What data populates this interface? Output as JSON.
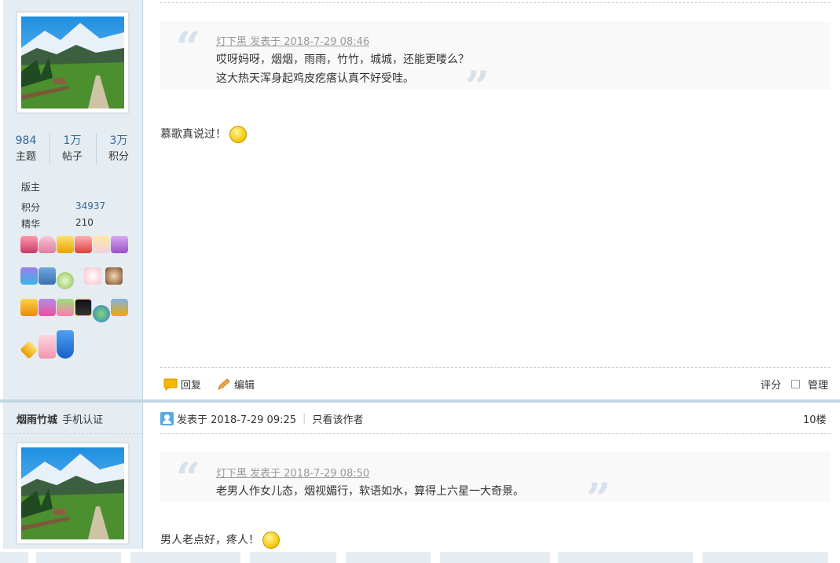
{
  "post1": {
    "stats": [
      {
        "num": "984",
        "label": "主题"
      },
      {
        "num": "1万",
        "label": "帖子"
      },
      {
        "num": "3万",
        "label": "积分"
      }
    ],
    "group": "版主",
    "points_label": "积分",
    "points_value": "34937",
    "digest_label": "精华",
    "digest_value": "210",
    "quote_header": "灯下黑 发表于 2018-7-29 08:46",
    "quote_line1": "哎呀妈呀，烟烟，雨雨，竹竹，城城，还能更喽么？",
    "quote_line2": "这大热天浑身起鸡皮疙瘩认真不好受哇。",
    "message": "慕歌真说过！",
    "reply": "回复",
    "edit": "编辑",
    "rate": "评分",
    "manage": "管理"
  },
  "post2": {
    "author": "烟雨竹城",
    "verify": "手机认证",
    "posted": "发表于 2018-7-29 09:25",
    "only_author": "只看该作者",
    "floor": "10楼",
    "quote_header": "灯下黑 发表于 2018-7-29 08:50",
    "quote_line1": "老男人作女儿态，烟视媚行，软语如水，算得上六星一大奇景。",
    "message": "男人老点好，疼人！"
  },
  "colors": {
    "sidebar_bg": "#E5EDF2",
    "border": "#C2D5E3",
    "link": "#336699",
    "quote_bg": "#F9F9F9"
  },
  "icons": [
    "reply-bubble-icon",
    "pencil-icon",
    "checkbox-icon",
    "user-icon",
    "smiley-icon"
  ]
}
